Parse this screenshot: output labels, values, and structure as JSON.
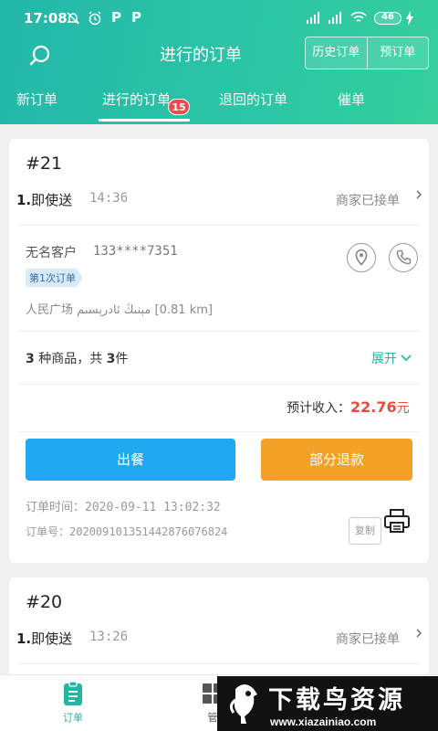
{
  "status_bar": {
    "time": "17:08",
    "battery": "46"
  },
  "header": {
    "title": "进行的订单",
    "history_button": "历史订单",
    "preorder_button": "预订单"
  },
  "tabs": [
    {
      "label": "新订单"
    },
    {
      "label": "进行的订单",
      "badge": "15",
      "active": true
    },
    {
      "label": "退回的订单"
    },
    {
      "label": "催单"
    }
  ],
  "orders": [
    {
      "number": "#21",
      "delivery_index": "1.",
      "delivery_type": "即使送",
      "delivery_time": "14:36",
      "status": "商家已接单",
      "customer_name": "无名客户",
      "customer_phone": "133****7351",
      "order_count_tag": "第1次订单",
      "address": "人民广场 مېنىڭ ئادرېسىم [0.81 km]",
      "items_count": "3",
      "items_text_1": " 种商品，共 ",
      "items_quantity": "3",
      "items_text_2": "件",
      "expand_label": "展开",
      "income_label": "预计收入：",
      "income_value": "22.76",
      "income_unit": "元",
      "serve_button": "出餐",
      "partial_refund_button": "部分退款",
      "order_time_label": "订单时间：",
      "order_time": "2020-09-11 13:02:32",
      "order_no_label": "订单号：",
      "order_no": "2020091013514428760768​24",
      "copy_button": "复制"
    },
    {
      "number": "#20",
      "delivery_index": "1.",
      "delivery_type": "即使送",
      "delivery_time": "13:26",
      "status": "商家已接单"
    }
  ],
  "bottom_nav": {
    "orders_label": "订单",
    "manage_label": "管"
  },
  "watermark": {
    "title": "下载鸟资源",
    "url": "www.xiazainiao.com"
  },
  "colors": {
    "header": "#2bc6a5",
    "accent": "#24b5a2",
    "serve_button": "#1fa8ef",
    "refund_button": "#f3a227",
    "income": "#e84a3f",
    "badge": "#ef4b4b"
  }
}
